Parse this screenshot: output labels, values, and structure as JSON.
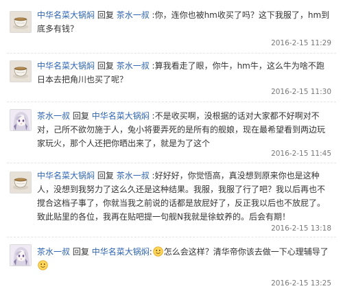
{
  "replies": [
    {
      "author": "中华名菜大锅焖",
      "reply_word": "回复",
      "target": "茶水一叔",
      "text": ":你，连你也被hm收买了吗？这下我服了，hm到底多有钱？",
      "timestamp": "2016-2-15 11:29",
      "reply_link": "回复",
      "avatar_icon": "teacup-avatar-icon"
    },
    {
      "author": "中华名菜大锅焖",
      "reply_word": "回复",
      "target": "茶水一叔",
      "text": ":算我看走了眼，你牛，hm牛，这么牛为啥不跑日本去把角川也买了呢？",
      "timestamp": "2016-2-15 11:30",
      "reply_link": "回复",
      "avatar_icon": "teacup-avatar-icon"
    },
    {
      "author": "茶水一叔",
      "reply_word": "回复",
      "target": "中华名菜大锅焖",
      "text": ":不是收买啊，没根据的话对大家都不好啊对不对，己所不欲勿施于人，兔小将要弄死的是所有的舰娘，现在最希望看到两边玩家玩火，那个人还把你晒出来了，就是为了这个",
      "timestamp": "2016-2-15 11:45",
      "reply_link": "回复",
      "avatar_icon": "anime-girl-avatar-icon"
    },
    {
      "author": "中华名菜大锅焖",
      "reply_word": "回复",
      "target": "茶水一叔",
      "text": ":好好好，你觉悟高，真没想到原来你也是这种人，没想到我努力了这么久还是这种结果。我服，我服了行了吧？我以后再也不搅合这档子事了，你就当我之前说的话都是放屁好了，反正我以后也不放屁了。致此贴里的各位，我再在贴吧提一句舰N我就是徐蚊养的。后会有期！",
      "timestamp": "2016-2-15 13:18",
      "reply_link": "回复",
      "avatar_icon": "teacup-avatar-icon"
    },
    {
      "author": "茶水一叔",
      "reply_word": "回复",
      "target": "中华名菜大锅焖",
      "text_before_emoji": ":",
      "emoji_1": "smiley-emoji-icon",
      "text_middle": "怎么会这样？清华帝你该去做一下心理辅导了",
      "emoji_2": "smiley-emoji-icon",
      "timestamp": "2016-2-15 13:25",
      "reply_link": "回复",
      "avatar_icon": "anime-girl-avatar-icon"
    }
  ]
}
